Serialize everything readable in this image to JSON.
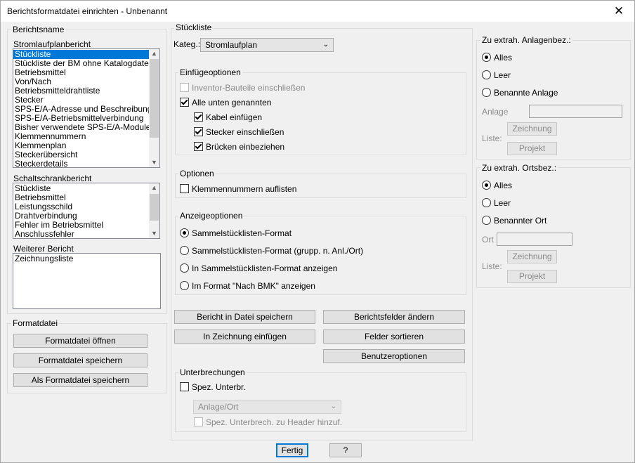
{
  "window": {
    "title": "Berichtsformatdatei einrichten - Unbenannt",
    "close_glyph": "✕"
  },
  "berichtsname": {
    "group_label": "Berichtsname",
    "stromlaufplan": {
      "label": "Stromlaufplanbericht",
      "items": [
        "Stückliste",
        "Stückliste der BM ohne Katalogdaten",
        "Betriebsmittel",
        "Von/Nach",
        "Betriebsmitteldrahtliste",
        "Stecker",
        "SPS-E/A-Adresse und Beschreibungen",
        "SPS-E/A-Betriebsmittelverbindung",
        "Bisher verwendete SPS-E/A-Module",
        "Klemmennummern",
        "Klemmenplan",
        "Steckerübersicht",
        "Steckerdetails"
      ],
      "selected": "Stückliste"
    },
    "schaltschrank": {
      "label": "Schaltschrankbericht",
      "items": [
        "Stückliste",
        "Betriebsmittel",
        "Leistungsschild",
        "Drahtverbindung",
        "Fehler im Betriebsmittel",
        "Anschlussfehler"
      ]
    },
    "weiterer": {
      "label": "Weiterer Bericht",
      "items": [
        "Zeichnungsliste"
      ]
    }
  },
  "formatdatei": {
    "group_label": "Formatdatei",
    "open_label": "Formatdatei öffnen",
    "save_label": "Formatdatei speichern",
    "saveas_label": "Als Formatdatei speichern"
  },
  "stueckliste": {
    "group_label": "Stückliste",
    "kateg_label": "Kateg.:",
    "kateg_value": "Stromlaufplan",
    "einfuege": {
      "group_label": "Einfügeoptionen",
      "inventor": "Inventor-Bauteile einschließen",
      "alle": "Alle unten genannten",
      "kabel": "Kabel einfügen",
      "stecker": "Stecker einschließen",
      "bruecken": "Brücken einbeziehen"
    },
    "optionen": {
      "group_label": "Optionen",
      "klemmen": "Klemmennummern auflisten"
    },
    "anzeige": {
      "group_label": "Anzeigeoptionen",
      "opt1": "Sammelstücklisten-Format",
      "opt2": "Sammelstücklisten-Format (grupp. n. Anl./Ort)",
      "opt3": "In Sammelstücklisten-Format anzeigen",
      "opt4": "Im Format \"Nach BMK\" anzeigen"
    },
    "buttons": {
      "save_report": "Bericht in Datei speichern",
      "insert_drawing": "In Zeichnung einfügen",
      "change_fields": "Berichtsfelder ändern",
      "sort_fields": "Felder sortieren",
      "user_options": "Benutzeroptionen"
    },
    "unterbrechungen": {
      "group_label": "Unterbrechungen",
      "spez": "Spez. Unterbr.",
      "combo_value": "Anlage/Ort",
      "header": "Spez. Unterbrech. zu Header hinzuf."
    }
  },
  "anlagenbez": {
    "group_label": "Zu extrah. Anlagenbez.:",
    "alles": "Alles",
    "leer": "Leer",
    "benannte": "Benannte Anlage",
    "anlage_label": "Anlage",
    "liste_label": "Liste:",
    "zeichnung": "Zeichnung",
    "projekt": "Projekt"
  },
  "ortsbez": {
    "group_label": "Zu extrah. Ortsbez.:",
    "alles": "Alles",
    "leer": "Leer",
    "benannter": "Benannter Ort",
    "ort_label": "Ort",
    "liste_label": "Liste:",
    "zeichnung": "Zeichnung",
    "projekt": "Projekt"
  },
  "footer": {
    "fertig": "Fertig",
    "help": "?"
  }
}
